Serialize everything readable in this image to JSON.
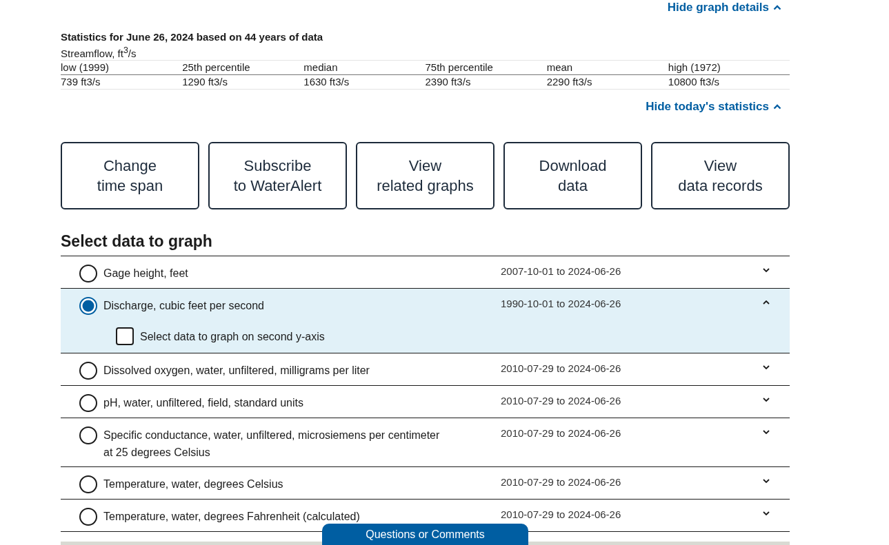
{
  "graph_details_toggle": {
    "label": "Hide graph details",
    "expanded": true
  },
  "statistics": {
    "title": "Statistics for June 26, 2024 based on 44 years of data",
    "parameter": "Streamflow, ft$^{3}$/s",
    "columns": [
      "low (1999)",
      "25th percentile",
      "median",
      "75th percentile",
      "mean",
      "high (1972)"
    ],
    "values": [
      "739 ft3/s",
      "1290 ft3/s",
      "1630 ft3/s",
      "2390 ft3/s",
      "2290 ft3/s",
      "10800 ft3/s"
    ]
  },
  "statistics_toggle": {
    "label": "Hide today's statistics",
    "expanded": true
  },
  "action_buttons": [
    {
      "lines": [
        "Change",
        "time span"
      ]
    },
    {
      "lines": [
        "Subscribe",
        "to WaterAlert"
      ]
    },
    {
      "lines": [
        "View",
        "related graphs"
      ]
    },
    {
      "lines": [
        "Download",
        "data"
      ]
    },
    {
      "lines": [
        "View",
        "data records"
      ]
    }
  ],
  "data_selection": {
    "title": "Select data to graph",
    "parameters": [
      {
        "label": "Gage height, feet",
        "period": "2007-10-01 to 2024-06-26",
        "selected": false,
        "expanded": false
      },
      {
        "label": "Discharge, cubic feet per second",
        "period": "1990-10-01 to 2024-06-26",
        "selected": true,
        "expanded": true,
        "second_axis": {
          "label": "Select data to graph on second y-axis",
          "checked": false
        }
      },
      {
        "label": "Dissolved oxygen, water, unfiltered, milligrams per liter",
        "period": "2010-07-29 to 2024-06-26",
        "selected": false,
        "expanded": false
      },
      {
        "label": "pH, water, unfiltered, field, standard units",
        "period": "2010-07-29 to 2024-06-26",
        "selected": false,
        "expanded": false
      },
      {
        "label": "Specific conductance, water, unfiltered, microsiemens per centimeter at 25 degrees Celsius",
        "period": "2010-07-29 to 2024-06-26",
        "selected": false,
        "expanded": false
      },
      {
        "label": "Temperature, water, degrees Celsius",
        "period": "2010-07-29 to 2024-06-26",
        "selected": false,
        "expanded": false
      },
      {
        "label": "Temperature, water, degrees Fahrenheit (calculated)",
        "period": "2010-07-29 to 2024-06-26",
        "selected": false,
        "expanded": false
      }
    ]
  },
  "feedback_button": {
    "label": "Questions or Comments"
  }
}
